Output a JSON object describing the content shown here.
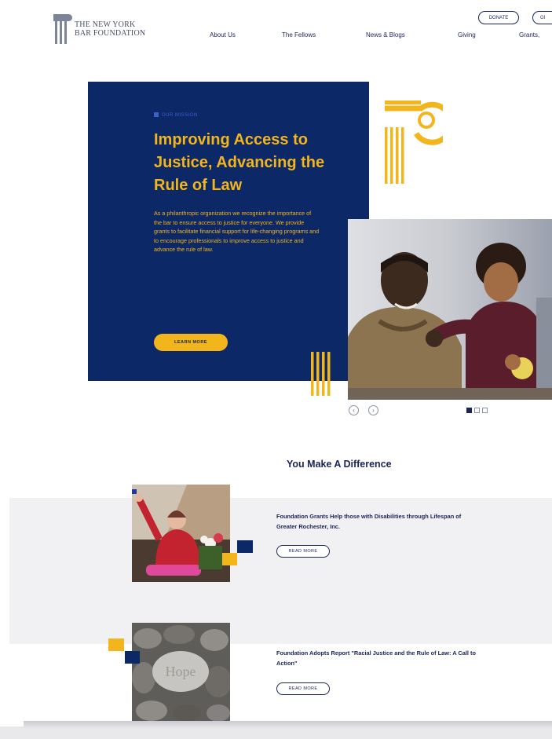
{
  "brand": {
    "logo_line1": "THE NEW YORK",
    "logo_line2": "BAR FOUNDATION"
  },
  "nav": {
    "items": [
      "About Us",
      "The Fellows",
      "News & Blogs",
      "Giving",
      "Grants, "
    ]
  },
  "header_buttons": {
    "donate": "DONATE",
    "second": "GI"
  },
  "hero": {
    "eyebrow": "OUR MISSION",
    "title": "Improving Access to Justice, Advancing the Rule of Law",
    "body": "As a philanthropic organization we recognize the importance of the bar to ensure access to justice for everyone. We provide grants to facilitate financial support for life-changing programs and to encourage professionals to improve access to justice and advance the rule of law.",
    "cta": "LEARN MORE",
    "slider_prev": "‹",
    "slider_next": "›"
  },
  "section": {
    "title": "You Make A Difference",
    "cards": [
      {
        "title": "Foundation Grants Help those with Disabilities through Lifespan of Greater Rochester, Inc.",
        "button": "READ MORE"
      },
      {
        "title": "Foundation Adopts Report \"Racial Justice and the Rule of Law: A Call to Action\"",
        "button": "READ MORE"
      }
    ]
  },
  "colors": {
    "navy": "#0d2867",
    "gold": "#f2b51c",
    "text_navy": "#1b2457"
  },
  "icons": {
    "logo": "column-logo-icon",
    "deco": "ionic-column-icon",
    "prev": "chevron-left-icon",
    "next": "chevron-right-icon"
  }
}
